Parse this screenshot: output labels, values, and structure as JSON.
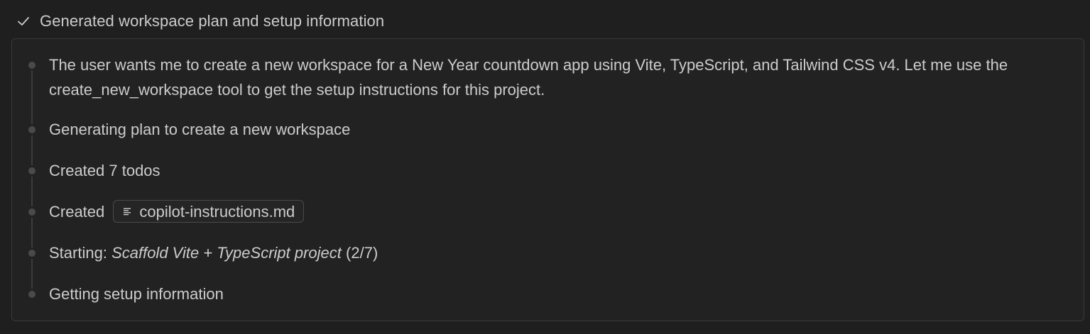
{
  "header": {
    "title": "Generated workspace plan and setup information",
    "icon": "check-icon"
  },
  "steps": {
    "thinking": "The user wants me to create a new workspace for a New Year countdown app using Vite, TypeScript, and Tailwind CSS v4. Let me use the create_new_workspace tool to get the setup instructions for this project.",
    "plan": "Generating plan to create a new workspace",
    "todos": "Created 7 todos",
    "created_prefix": "Created",
    "created_file": "copilot-instructions.md",
    "created_file_icon": "markdown-file-icon",
    "starting_prefix": "Starting:",
    "starting_task": "Scaffold Vite + TypeScript project",
    "starting_progress": "(2/7)",
    "setup": "Getting setup information"
  },
  "colors": {
    "background": "#1f1f1f",
    "panel": "#222222",
    "border": "#3a3a3a",
    "text": "#cccccc"
  }
}
